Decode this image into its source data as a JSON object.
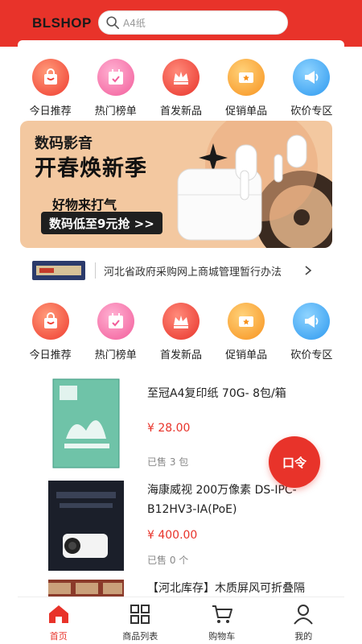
{
  "header": {
    "logo": "BLSHOP",
    "search_placeholder": "A4纸",
    "accent_color": "#e8332a"
  },
  "categories": [
    {
      "label": "今日推荐",
      "icon": "shopping-bag-icon"
    },
    {
      "label": "热门榜单",
      "icon": "calendar-check-icon"
    },
    {
      "label": "首发新品",
      "icon": "crown-icon"
    },
    {
      "label": "促销单品",
      "icon": "ticket-icon"
    },
    {
      "label": "砍价专区",
      "icon": "megaphone-icon"
    }
  ],
  "banner": {
    "line1": "数码影音",
    "line2": "开春焕新季",
    "line3": "好物来打气",
    "line4": "数码低至9元抢 >>"
  },
  "notice": {
    "text": "河北省政府采购网上商城管理暂行办法"
  },
  "products": [
    {
      "name": "至冠A4复印纸 70G- 8包/箱",
      "price": "¥ 28.00",
      "sold": "已售 3 包"
    },
    {
      "name": "海康威视 200万像素 DS-IPC-B12HV3-IA(PoE)",
      "price": "¥ 400.00",
      "sold": "已售 0 个"
    },
    {
      "name": "【河北库存】木质屏风可折叠隔"
    }
  ],
  "fab": {
    "label": "口令"
  },
  "tabbar": [
    {
      "label": "首页",
      "icon": "home-icon",
      "active": true
    },
    {
      "label": "商品列表",
      "icon": "grid-icon",
      "active": false
    },
    {
      "label": "购物车",
      "icon": "cart-icon",
      "active": false
    },
    {
      "label": "我的",
      "icon": "user-icon",
      "active": false
    }
  ]
}
